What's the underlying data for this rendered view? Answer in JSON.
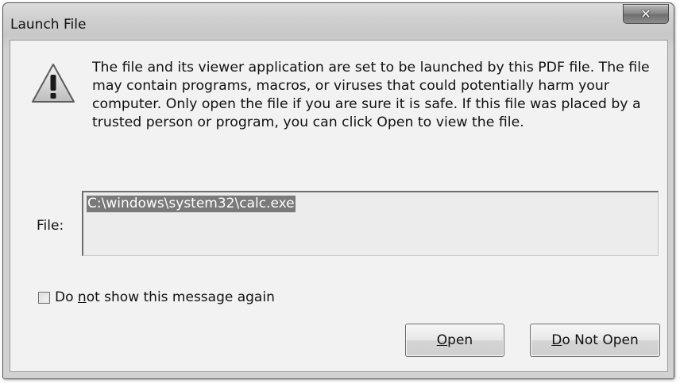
{
  "window": {
    "title": "Launch File"
  },
  "icons": {
    "warning": "warning-triangle-icon",
    "close": "close-icon"
  },
  "message": {
    "text": "The file and its viewer application are set to be launched by this PDF file. The file may contain programs, macros, or viruses that could potentially harm your computer. Only open the file if you are sure it is safe. If this file was placed by a trusted person or program, you can click Open to view the file."
  },
  "file": {
    "label": "File:",
    "path": "C:\\windows\\system32\\calc.exe"
  },
  "checkbox": {
    "label_pre": "Do ",
    "label_accel": "n",
    "label_post": "ot show this message again",
    "checked": false
  },
  "buttons": {
    "open_accel": "O",
    "open_rest": "pen",
    "donot_accel": "D",
    "donot_rest": "o Not Open"
  }
}
